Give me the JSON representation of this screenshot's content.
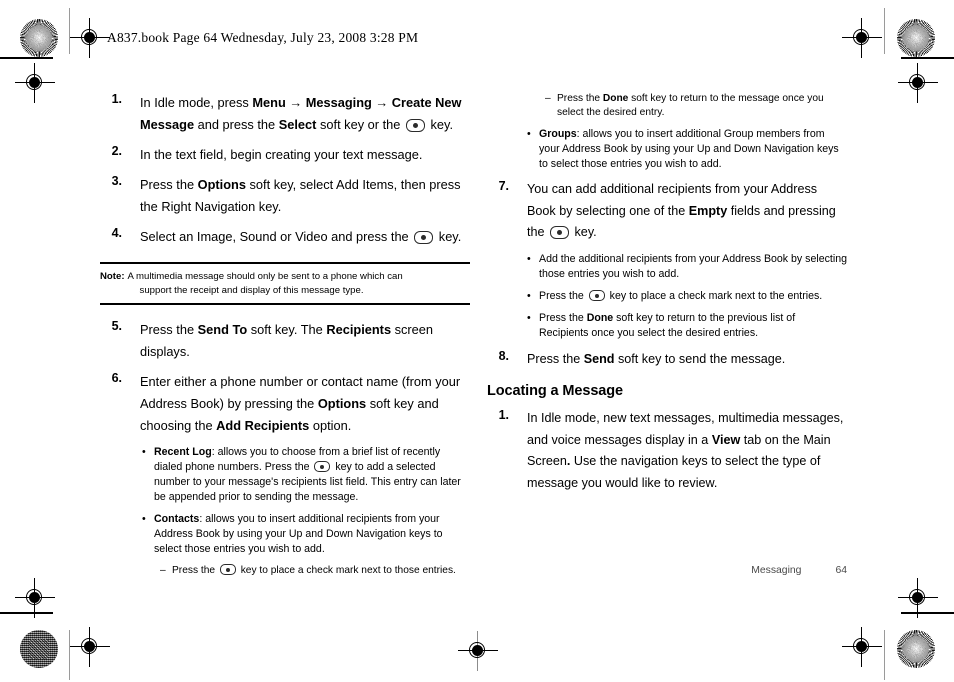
{
  "header": {
    "text": "A837.book  Page 64  Wednesday, July 23, 2008  3:28 PM"
  },
  "left_column": {
    "steps": [
      {
        "num": "1.",
        "parts": [
          {
            "t": "In Idle mode, press ",
            "b": false
          },
          {
            "t": "Menu → Messaging → Create New Message",
            "b": true
          },
          {
            "t": " and press the ",
            "b": false
          },
          {
            "t": "Select",
            "b": true
          },
          {
            "t": " soft key or the ",
            "b": false
          },
          {
            "t": "[key]",
            "b": false
          },
          {
            "t": " key.",
            "b": false
          }
        ]
      },
      {
        "num": "2.",
        "parts": [
          {
            "t": "In the text field, begin creating your text message.",
            "b": false
          }
        ]
      },
      {
        "num": "3.",
        "parts": [
          {
            "t": "Press the ",
            "b": false
          },
          {
            "t": "Options",
            "b": true
          },
          {
            "t": " soft key, select Add Items, then press the Right Navigation key.",
            "b": false
          }
        ]
      },
      {
        "num": "4.",
        "parts": [
          {
            "t": "Select an Image, Sound or Video and press the ",
            "b": false
          },
          {
            "t": "[key]",
            "b": false
          },
          {
            "t": " key.",
            "b": false
          }
        ]
      }
    ],
    "note": {
      "label": "Note:",
      "line1": "A multimedia message should only be sent to a phone which can",
      "line2": "support the receipt and display of this message type."
    },
    "steps_after_note": [
      {
        "num": "5.",
        "parts": [
          {
            "t": "Press the ",
            "b": false
          },
          {
            "t": "Send To",
            "b": true
          },
          {
            "t": " soft key. The ",
            "b": false
          },
          {
            "t": "Recipients",
            "b": true
          },
          {
            "t": " screen displays.",
            "b": false
          }
        ]
      },
      {
        "num": "6.",
        "parts": [
          {
            "t": "Enter either a phone number or contact name (from your Address Book) by pressing the ",
            "b": false
          },
          {
            "t": "Options",
            "b": true
          },
          {
            "t": " soft key and choosing the ",
            "b": false
          },
          {
            "t": "Add Recipients",
            "b": true
          },
          {
            "t": " option.",
            "b": false
          }
        ]
      }
    ],
    "bullets": [
      {
        "mark": "•",
        "parts": [
          {
            "t": "Recent Log",
            "b": true
          },
          {
            "t": ": allows you to choose from a brief list of recently dialed phone numbers. Press the ",
            "b": false
          },
          {
            "t": "[key]",
            "b": false
          },
          {
            "t": " key to add a selected number to your message's recipients list field. This entry can later be appended prior to sending the message.",
            "b": false
          }
        ]
      },
      {
        "mark": "•",
        "parts": [
          {
            "t": "Contacts",
            "b": true
          },
          {
            "t": ": allows you to insert additional recipients from your Address Book by using your Up and Down Navigation keys to select those entries you wish to add.",
            "b": false
          }
        ]
      }
    ],
    "dash_item": {
      "mark": "–",
      "parts": [
        {
          "t": "Press the ",
          "b": false
        },
        {
          "t": "[key]",
          "b": false
        },
        {
          "t": " key to place a check mark next to those entries.",
          "b": false
        }
      ]
    }
  },
  "right_column": {
    "top_dash": {
      "mark": "–",
      "parts": [
        {
          "t": "Press the ",
          "b": false
        },
        {
          "t": "Done",
          "b": true
        },
        {
          "t": " soft key to return to the message once you select the desired entry.",
          "b": false
        }
      ]
    },
    "groups_bullet": {
      "mark": "•",
      "parts": [
        {
          "t": "Groups",
          "b": true
        },
        {
          "t": ": allows you to insert additional Group members from your Address Book by using your Up and Down Navigation keys to select those entries you wish to add.",
          "b": false
        }
      ]
    },
    "step7": {
      "num": "7.",
      "parts": [
        {
          "t": "You can add additional recipients from your Address Book by selecting one of the ",
          "b": false
        },
        {
          "t": "Empty",
          "b": true
        },
        {
          "t": " fields and pressing the ",
          "b": false
        },
        {
          "t": "[key]",
          "b": false
        },
        {
          "t": " key.",
          "b": false
        }
      ]
    },
    "step7_bullets": [
      {
        "mark": "•",
        "parts": [
          {
            "t": "Add the additional recipients from your Address Book by selecting those entries you wish to add.",
            "b": false
          }
        ]
      },
      {
        "mark": "•",
        "parts": [
          {
            "t": "Press the ",
            "b": false
          },
          {
            "t": "[key]",
            "b": false
          },
          {
            "t": " key to place a check mark next to the entries.",
            "b": false
          }
        ]
      },
      {
        "mark": "•",
        "parts": [
          {
            "t": "Press the ",
            "b": false
          },
          {
            "t": "Done",
            "b": true
          },
          {
            "t": " soft key to return to the previous list of Recipients once you select the desired entries.",
            "b": false
          }
        ]
      }
    ],
    "step8": {
      "num": "8.",
      "parts": [
        {
          "t": "Press the ",
          "b": false
        },
        {
          "t": "Send",
          "b": true
        },
        {
          "t": " soft key to send the message.",
          "b": false
        }
      ]
    },
    "heading": "Locating a Message",
    "step_locating_1": {
      "num": "1.",
      "parts": [
        {
          "t": "In Idle mode, new text messages, multimedia messages, and voice messages display in a ",
          "b": false
        },
        {
          "t": "View",
          "b": true
        },
        {
          "t": " tab on the Main Screen",
          "b": false
        },
        {
          "t": ".",
          "b": true
        },
        {
          "t": " Use the navigation keys to select the type of message you would like to review.",
          "b": false
        }
      ]
    }
  },
  "footer": {
    "chapter": "Messaging",
    "page_number": "64"
  },
  "colors": {
    "ink": "#000000",
    "footer_gray": "#4a4a4a",
    "mark_gray": "#9a9a9a"
  }
}
